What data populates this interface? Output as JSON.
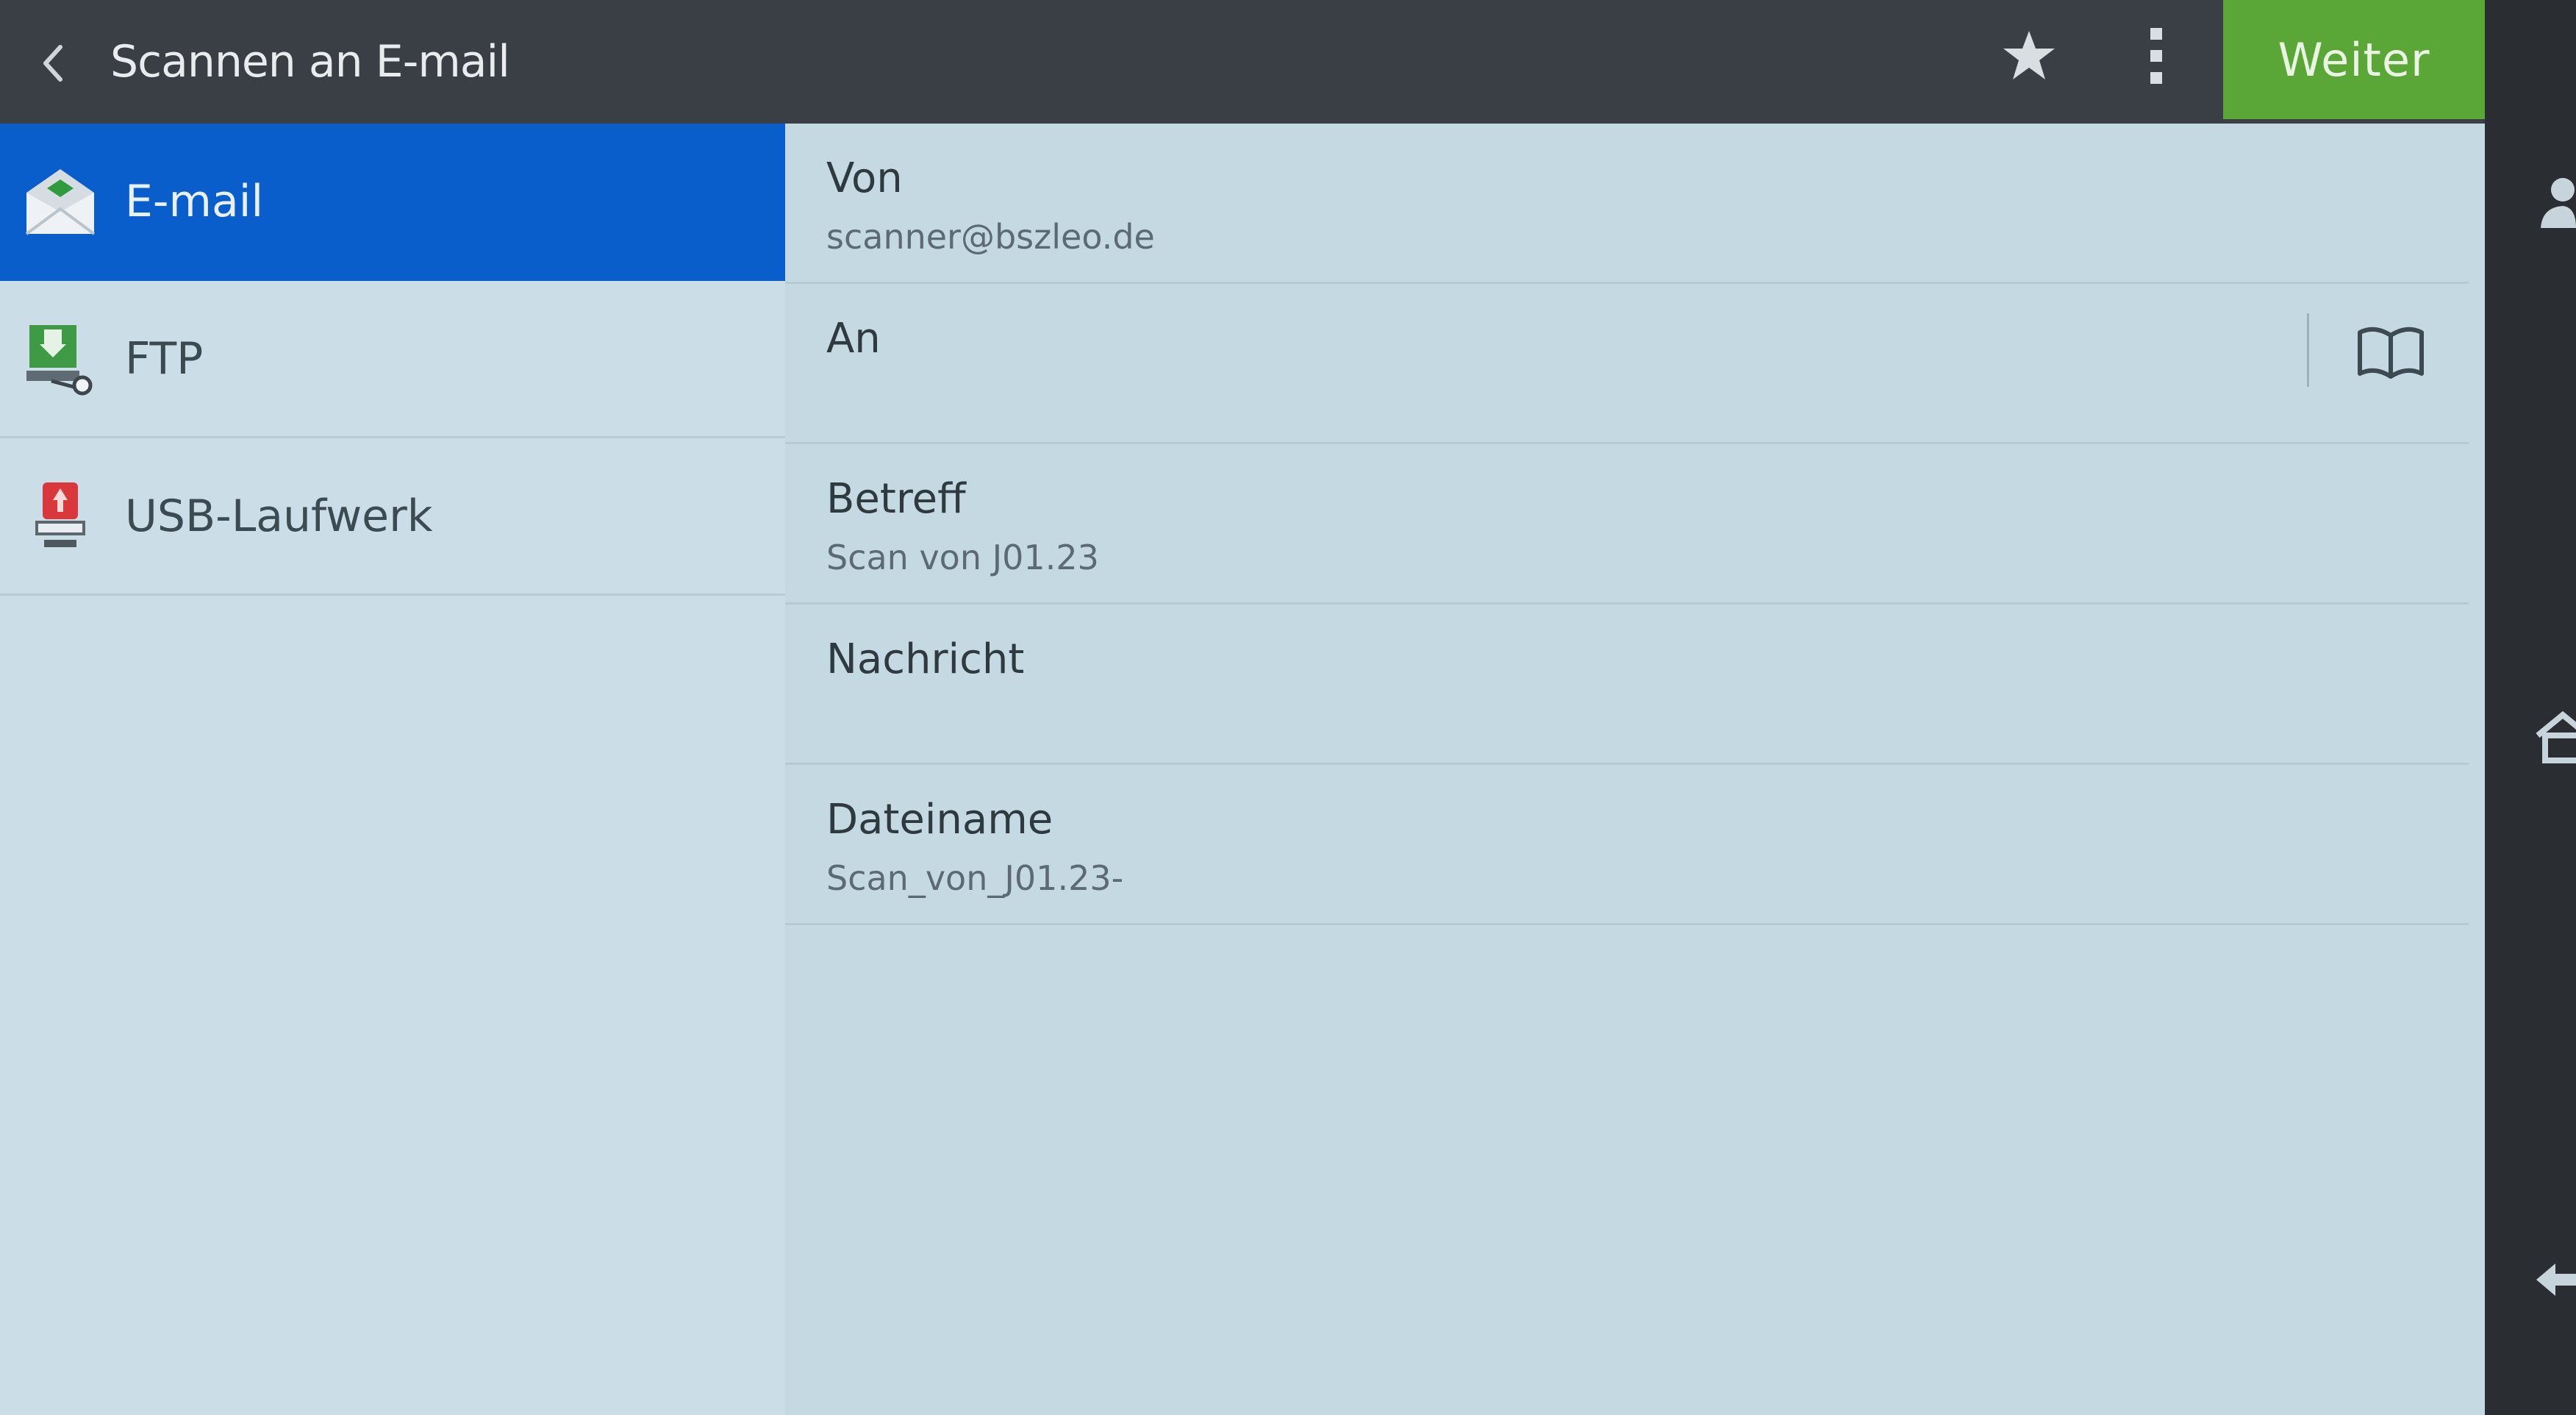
{
  "header": {
    "title": "Scannen an E-mail",
    "next_label": "Weiter"
  },
  "sidebar": {
    "items": [
      {
        "label": "E-mail",
        "icon": "email-envelope-icon",
        "selected": true
      },
      {
        "label": "FTP",
        "icon": "ftp-server-icon",
        "selected": false
      },
      {
        "label": "USB-Laufwerk",
        "icon": "usb-drive-icon",
        "selected": false
      }
    ]
  },
  "form": {
    "fields": [
      {
        "label": "Von",
        "value": "scanner@bszleo.de"
      },
      {
        "label": "An",
        "value": ""
      },
      {
        "label": "Betreff",
        "value": "Scan von J01.23"
      },
      {
        "label": "Nachricht",
        "value": ""
      },
      {
        "label": "Dateiname",
        "value": "Scan_von_J01.23-"
      }
    ]
  },
  "colors": {
    "accent_blue": "#0a5ecc",
    "next_green": "#5aa637",
    "topbar": "#3a3f45"
  }
}
